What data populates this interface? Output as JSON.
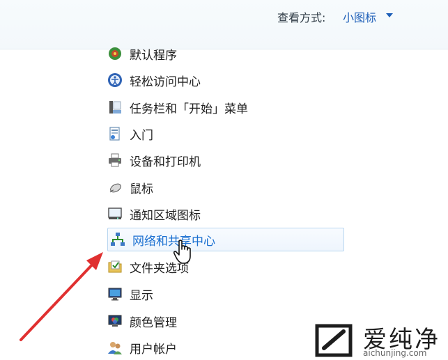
{
  "header": {
    "view_by_label": "查看方式:",
    "view_by_value": "小图标"
  },
  "items": [
    {
      "label": "默认程序",
      "icon": "default-programs-icon"
    },
    {
      "label": "轻松访问中心",
      "icon": "ease-of-access-icon"
    },
    {
      "label": "任务栏和「开始」菜单",
      "icon": "taskbar-icon"
    },
    {
      "label": "入门",
      "icon": "getting-started-icon"
    },
    {
      "label": "设备和打印机",
      "icon": "printer-icon"
    },
    {
      "label": "鼠标",
      "icon": "mouse-icon"
    },
    {
      "label": "通知区域图标",
      "icon": "notification-area-icon"
    },
    {
      "label": "网络和共享中心",
      "icon": "network-icon",
      "hovered": true
    },
    {
      "label": "文件夹选项",
      "icon": "folder-options-icon"
    },
    {
      "label": "显示",
      "icon": "display-icon"
    },
    {
      "label": "颜色管理",
      "icon": "color-management-icon"
    },
    {
      "label": "用户帐户",
      "icon": "user-accounts-icon"
    }
  ],
  "watermark": {
    "cn": "爱纯净",
    "en": "aichunjing.com"
  },
  "colors": {
    "link": "#1e5fb8",
    "hover_text": "#1a6fd0",
    "annotation_arrow": "#e03030"
  }
}
